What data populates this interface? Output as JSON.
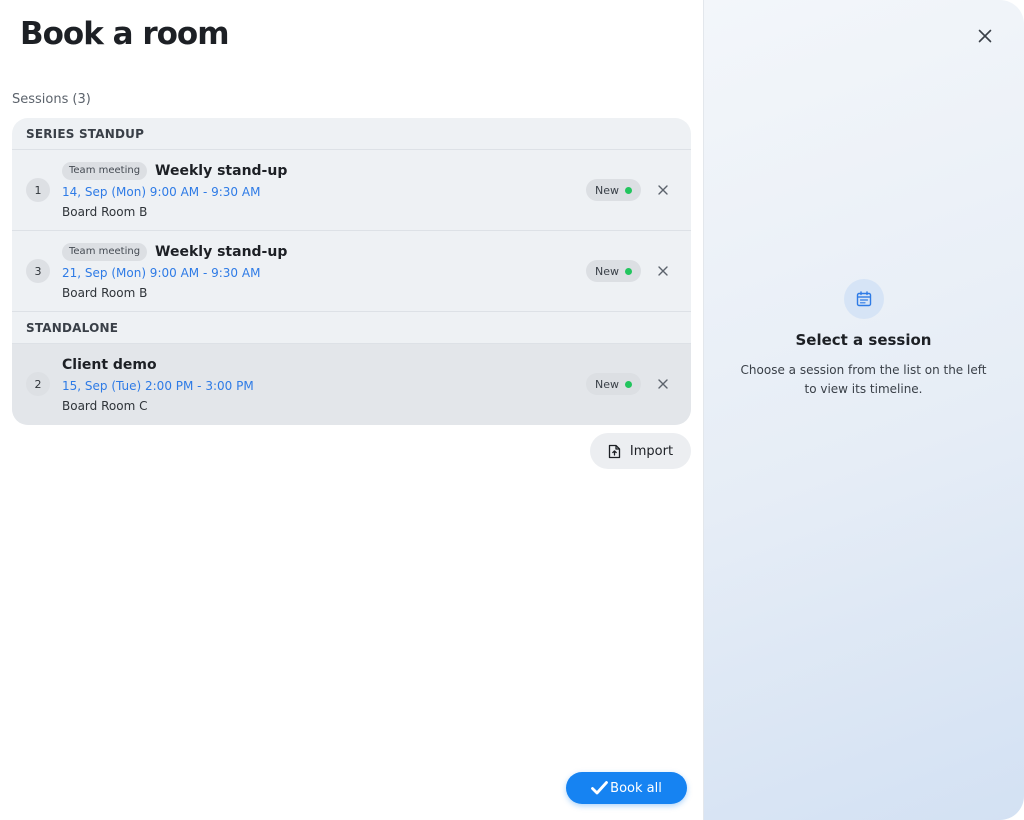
{
  "dialog": {
    "title": "Book a room",
    "close_icon": "close-icon"
  },
  "sessions": {
    "label": "Sessions",
    "count": "(3)",
    "groups": [
      {
        "header": "SERIES STANDUP",
        "items": [
          {
            "number": "1",
            "badge": "Team meeting",
            "title": "Weekly stand-up",
            "time": "14, Sep (Mon) 9:00 AM - 9:30 AM",
            "room": "Board Room B",
            "status": "New"
          },
          {
            "number": "3",
            "badge": "Team meeting",
            "title": "Weekly stand-up",
            "time": "21, Sep (Mon) 9:00 AM - 9:30 AM",
            "room": "Board Room B",
            "status": "New"
          }
        ]
      },
      {
        "header": "STANDALONE",
        "items": [
          {
            "number": "2",
            "title": "Client demo",
            "time": "15, Sep (Tue) 2:00 PM - 3:00 PM",
            "room": "Board Room C",
            "status": "New"
          }
        ]
      }
    ]
  },
  "actions": {
    "import_label": "Import",
    "import_icon": "file-upload-icon",
    "book_all_label": "Book all",
    "book_all_icon": "checkmark-icon"
  },
  "empty_state": {
    "icon": "calendar-icon",
    "title": "Select a session",
    "description": "Choose a session from the list on the left to view its timeline."
  },
  "colors": {
    "accent": "#1683f2",
    "link": "#2e7be6",
    "status_new": "#22c55e"
  }
}
